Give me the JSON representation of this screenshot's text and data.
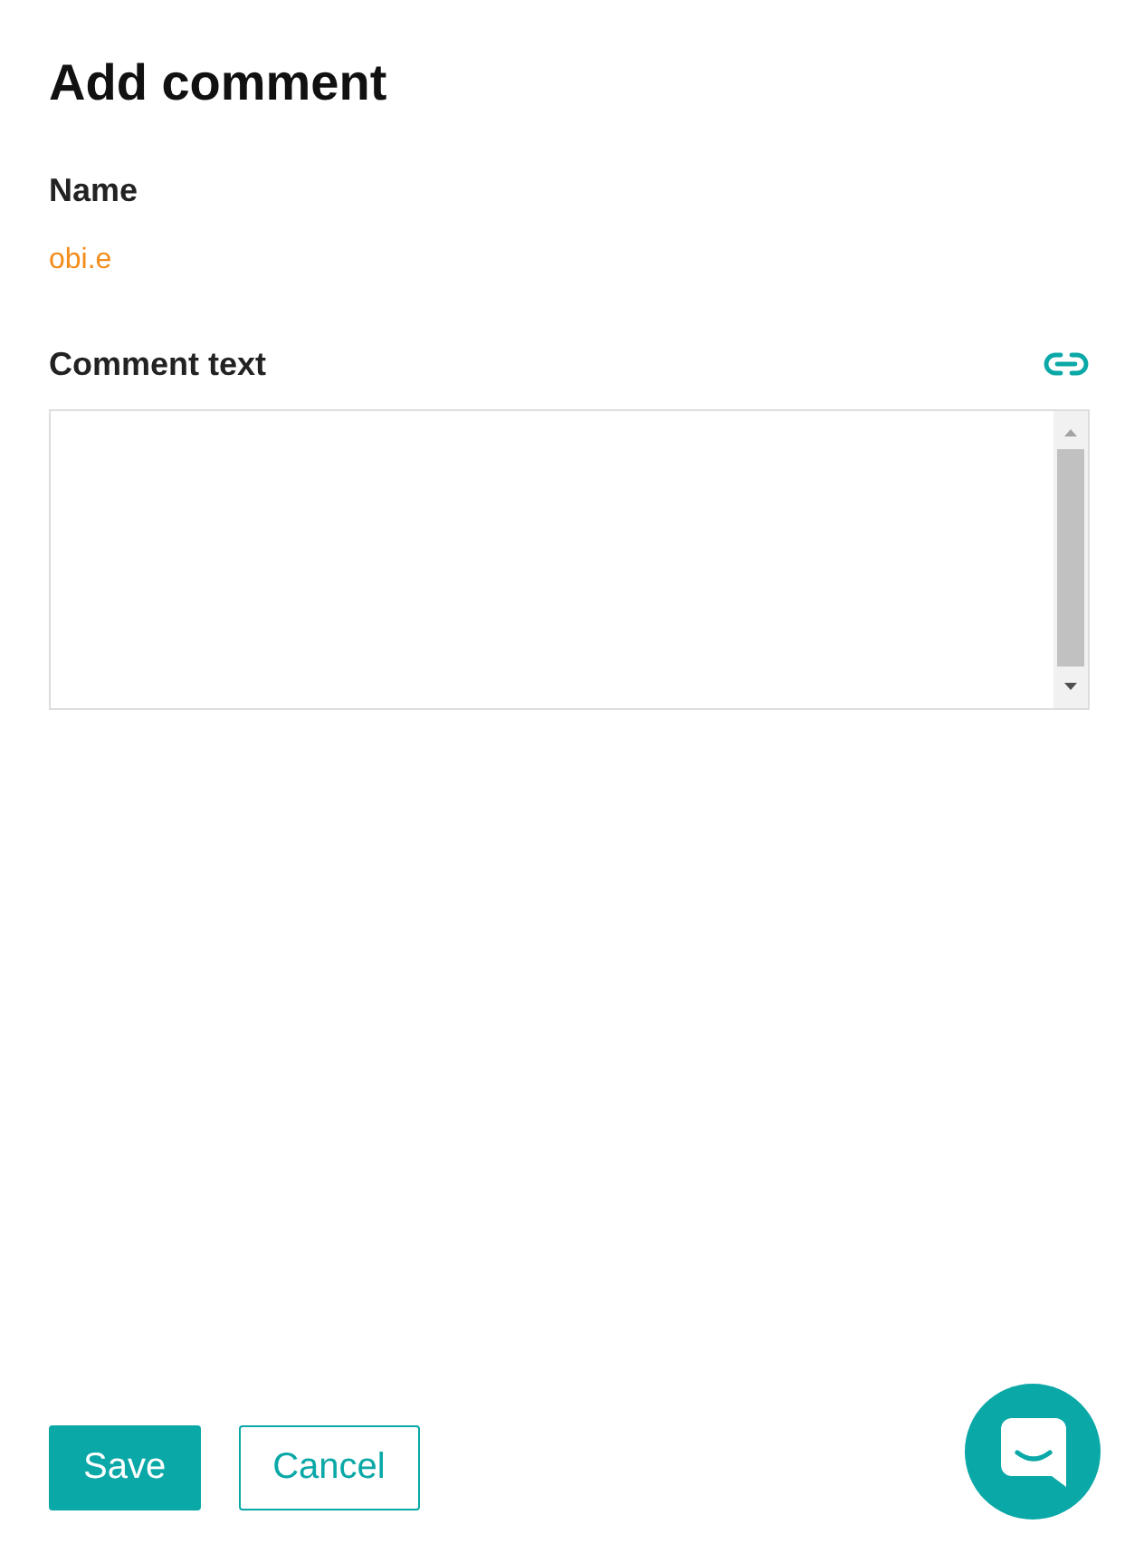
{
  "title": "Add comment",
  "name_field": {
    "label": "Name",
    "value": "obi.e"
  },
  "comment_field": {
    "label": "Comment text"
  },
  "buttons": [
    {
      "label": "Save",
      "kind": "primary"
    },
    {
      "label": "Cancel",
      "kind": "secondary"
    }
  ]
}
